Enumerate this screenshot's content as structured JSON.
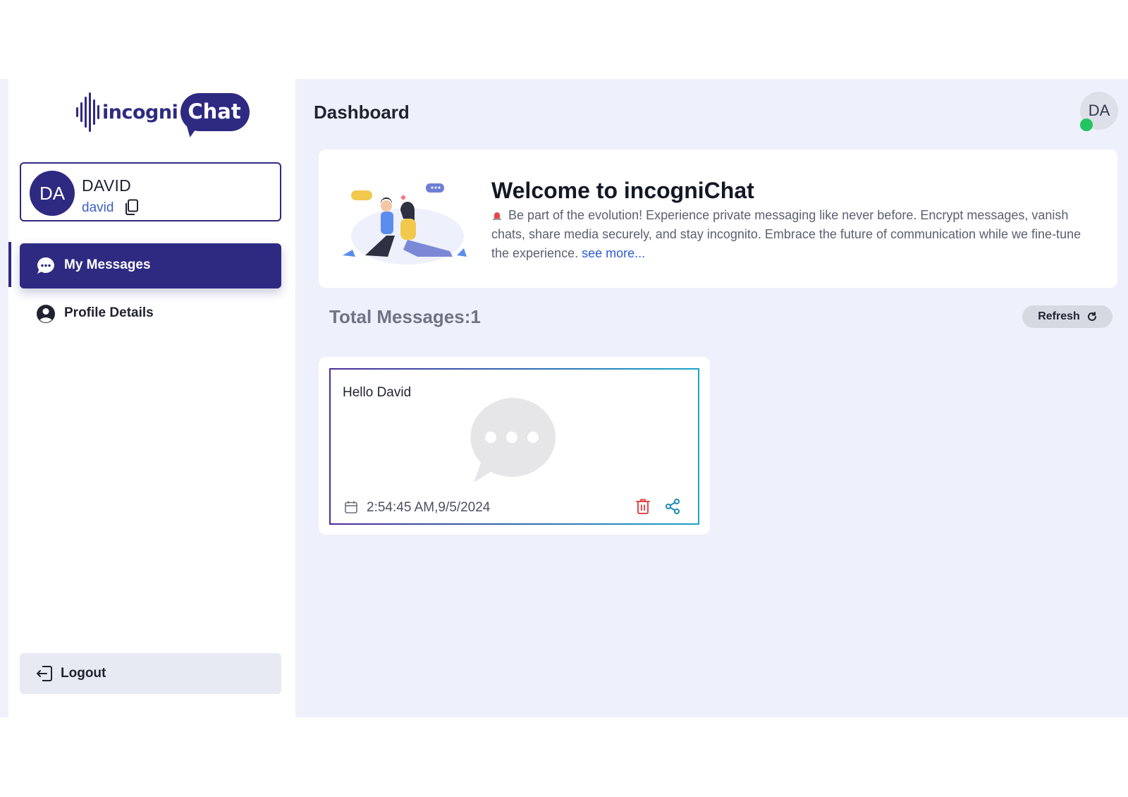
{
  "brand": {
    "name_part1": "incogni",
    "name_part2": "Chat"
  },
  "sidebar": {
    "user": {
      "initials": "DA",
      "name": "DAVID",
      "handle": "david"
    },
    "nav": [
      {
        "label": "My Messages",
        "icon": "chat-bubble-icon",
        "active": true
      },
      {
        "label": "Profile Details",
        "icon": "user-circle-icon",
        "active": false
      }
    ],
    "logout_label": "Logout"
  },
  "header": {
    "title": "Dashboard",
    "avatar_initials": "DA",
    "online": true
  },
  "welcome": {
    "title": "Welcome to incogniChat",
    "body": "Be part of the evolution! Experience private messaging like never before. Encrypt messages, vanish chats, share media securely, and stay incognito. Embrace the future of communication while we fine-tune the experience.",
    "link": "see more..."
  },
  "messages_section": {
    "total_label": "Total Messages:1",
    "refresh_label": "Refresh"
  },
  "messages": [
    {
      "text": "Hello David",
      "timestamp": "2:54:45 AM,9/5/2024"
    }
  ],
  "colors": {
    "primary": "#2e2a82",
    "online": "#22c55e",
    "delete": "#e5484d",
    "share": "#1b8bb5",
    "link": "#2b5bd7"
  }
}
